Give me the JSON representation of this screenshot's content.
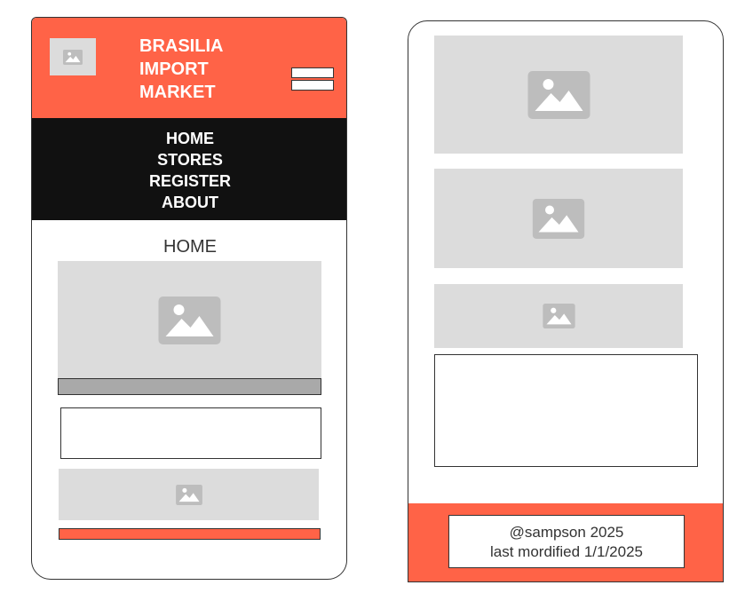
{
  "site": {
    "title_lines": [
      "BRASILIA",
      "IMPORT",
      "MARKET"
    ]
  },
  "nav": {
    "items": [
      "HOME",
      "STORES",
      "REGISTER",
      "ABOUT"
    ]
  },
  "main": {
    "heading": "HOME"
  },
  "footer": {
    "line1": "@sampson 2025",
    "line2": "last mordified 1/1/2025"
  },
  "colors": {
    "accent": "#ff6347",
    "nav_bg": "#111111",
    "placeholder": "#dcdcdc",
    "placeholder_icon": "#bdbdbd",
    "caption_bar": "#a9a9a9"
  },
  "icons": {
    "placeholder": "image-placeholder-icon",
    "menu": "hamburger-menu-icon"
  }
}
